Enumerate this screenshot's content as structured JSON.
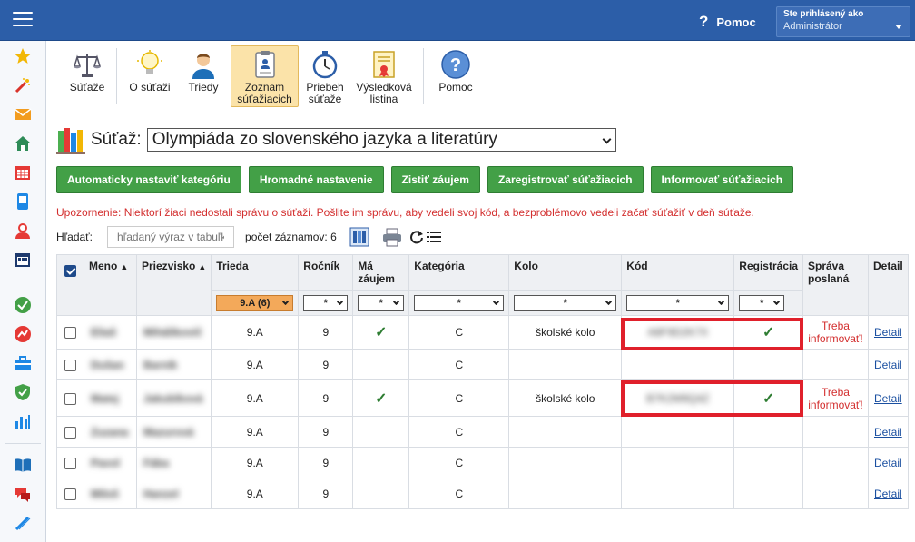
{
  "header": {
    "help_label": "Pomoc",
    "user_line1": "Ste prihlásený ako",
    "user_line2": "Administrátor",
    "bg_color": "#2c5ea8"
  },
  "sidebar": {
    "icons": [
      "star-icon",
      "magic-wand-icon",
      "mail-icon",
      "home-icon",
      "calendar-icon",
      "phone-icon",
      "user-icon",
      "schedule-icon",
      "check-circle-icon",
      "chart-line-icon",
      "briefcase-icon",
      "shield-icon",
      "bar-chart-icon",
      "book-icon",
      "chat-icon",
      "pencil-icon"
    ]
  },
  "toolbar": {
    "items": [
      {
        "label": "Súťaže",
        "icon": "scales-icon"
      },
      {
        "label": "O súťaži",
        "icon": "lightbulb-icon"
      },
      {
        "label": "Triedy",
        "icon": "student-icon"
      },
      {
        "label": "Zoznam súťažiacich",
        "icon": "clipboard-icon",
        "active": true
      },
      {
        "label": "Priebeh súťaže",
        "icon": "stopwatch-icon"
      },
      {
        "label": "Výsledková listina",
        "icon": "certificate-icon"
      },
      {
        "label": "Pomoc",
        "icon": "help-icon"
      }
    ]
  },
  "competition": {
    "label": "Súťaž:",
    "selected": "Olympiáda zo slovenského jazyka a literatúry"
  },
  "actions": {
    "auto_category": "Automaticky nastaviť kategóriu",
    "bulk_setting": "Hromadné nastavenie",
    "find_interest": "Zistiť záujem",
    "register": "Zaregistrovať súťažiacich",
    "inform": "Informovať súťažiacich"
  },
  "warning": "Upozornenie: Niektorí žiaci nedostali správu o súťaži. Pošlite im správu, aby vedeli svoj kód, a bezproblémovo vedeli začať súťažiť v deň súťaže.",
  "search": {
    "label": "Hľadať:",
    "placeholder": "hľadaný výraz v tabuľke",
    "count_text": "počet záznamov: 6"
  },
  "table": {
    "columns": [
      "Meno",
      "Priezvisko",
      "Trieda",
      "Ročník",
      "Má záujem",
      "Kategória",
      "Kolo",
      "Kód",
      "Registrácia",
      "Správa poslaná",
      "Detail"
    ],
    "filters": {
      "trieda": "9.A (6)",
      "rocnik": "*",
      "zaujem": "*",
      "kategoria": "*",
      "kolo": "*",
      "kod": "*",
      "registracia": "*"
    },
    "rows": [
      {
        "meno": "Eliaš",
        "priezvisko": "Mihálikovič",
        "trieda": "9.A",
        "rocnik": "9",
        "zaujem": "✓",
        "kategoria": "C",
        "kolo": "školské kolo",
        "kod": "A8F9D2K7X",
        "registracia": "✓",
        "sprava": "Treba informovať!",
        "detail": "Detail"
      },
      {
        "meno": "Dušan",
        "priezvisko": "Barník",
        "trieda": "9.A",
        "rocnik": "9",
        "zaujem": "",
        "kategoria": "C",
        "kolo": "",
        "kod": "",
        "registracia": "",
        "sprava": "",
        "detail": "Detail"
      },
      {
        "meno": "Matej",
        "priezvisko": "Jakubíková",
        "trieda": "9.A",
        "rocnik": "9",
        "zaujem": "✓",
        "kategoria": "C",
        "kolo": "školské kolo",
        "kod": "B7K2M9Q4Z",
        "registracia": "✓",
        "sprava": "Treba informovať!",
        "detail": "Detail"
      },
      {
        "meno": "Zuzana",
        "priezvisko": "Mazurová",
        "trieda": "9.A",
        "rocnik": "9",
        "zaujem": "",
        "kategoria": "C",
        "kolo": "",
        "kod": "",
        "registracia": "",
        "sprava": "",
        "detail": "Detail"
      },
      {
        "meno": "Pavol",
        "priezvisko": "Fába",
        "trieda": "9.A",
        "rocnik": "9",
        "zaujem": "",
        "kategoria": "C",
        "kolo": "",
        "kod": "",
        "registracia": "",
        "sprava": "",
        "detail": "Detail"
      },
      {
        "meno": "Miloš",
        "priezvisko": "Hanzel",
        "trieda": "9.A",
        "rocnik": "9",
        "zaujem": "",
        "kategoria": "C",
        "kolo": "",
        "kod": "",
        "registracia": "",
        "sprava": "",
        "detail": "Detail"
      }
    ]
  },
  "colors": {
    "accent_green": "#43a047",
    "warning_red": "#d32f2f",
    "highlight_box": "#e0202b"
  }
}
